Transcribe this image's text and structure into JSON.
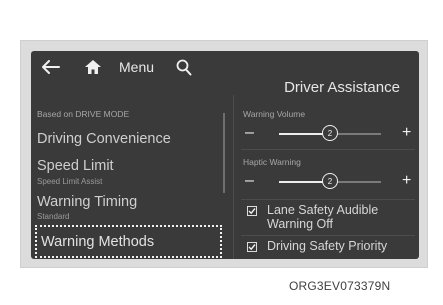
{
  "topbar": {
    "back_icon": "arrow-left-icon",
    "home_icon": "home-icon",
    "menu_label": "Menu",
    "search_icon": "search-icon"
  },
  "heading": "Driver Assistance",
  "left_panel": {
    "mode_label": "Based on DRIVE MODE",
    "items": [
      {
        "title": "Driving Convenience",
        "subtitle": ""
      },
      {
        "title": "Speed Limit",
        "subtitle": "Speed Limit Assist"
      },
      {
        "title": "Warning Timing",
        "subtitle": "Standard"
      },
      {
        "title": "Warning Methods",
        "subtitle": "",
        "selected": true
      }
    ]
  },
  "right_panel": {
    "sliders": [
      {
        "label": "Warning Volume",
        "value": "2",
        "minus": "–",
        "plus": "+",
        "level": 0.5
      },
      {
        "label": "Haptic Warning",
        "value": "2",
        "minus": "–",
        "plus": "+",
        "level": 0.5
      }
    ],
    "checkboxes": [
      {
        "label": "Lane Safety Audible Warning Off",
        "checked": true
      },
      {
        "label": "Driving Safety Priority",
        "checked": true
      }
    ]
  },
  "caption": "ORG3EV073379N",
  "colors": {
    "screen_bg": "#3a3a3a",
    "frame_bg": "#dcdcdc",
    "text": "#d6d6d6",
    "dim_text": "#a7a7a7"
  }
}
